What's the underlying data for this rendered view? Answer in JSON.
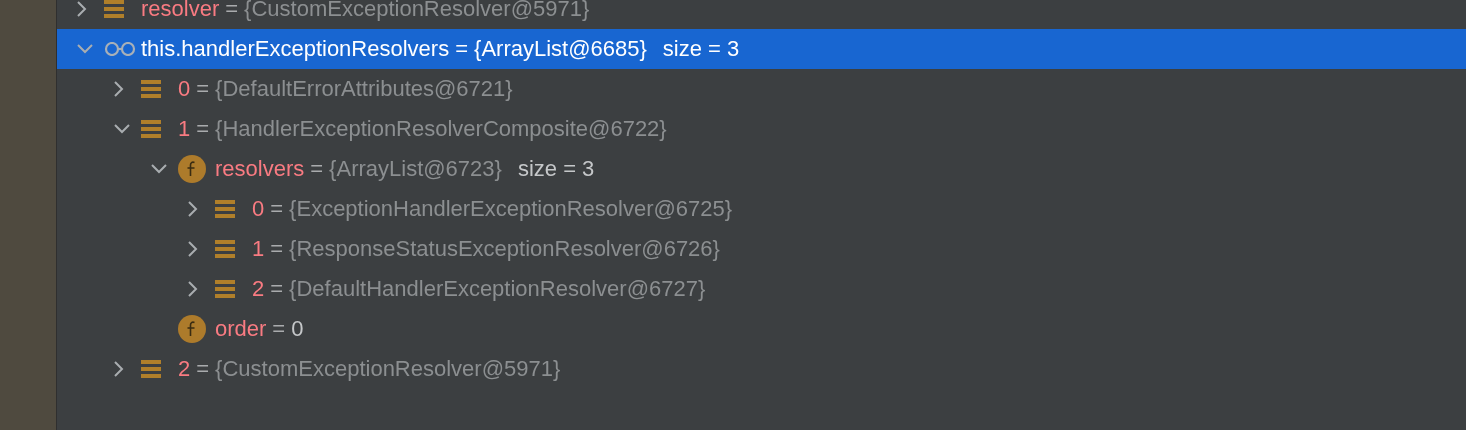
{
  "variables": [
    {
      "name": "resolver",
      "kind": "array",
      "operator": "=",
      "value": "{CustomExceptionResolver@5971}",
      "dimmed": true,
      "expanded": false,
      "selected": false
    },
    {
      "name": "this.handlerExceptionResolvers",
      "kind": "watch",
      "operator": "=",
      "value": "{ArrayList@6685}",
      "size": "size = 3",
      "dimmed": true,
      "expanded": true,
      "selected": true,
      "children": [
        {
          "name": "0",
          "kind": "array",
          "operator": "=",
          "value": "{DefaultErrorAttributes@6721}",
          "dimmed": true,
          "expanded": false,
          "selected": false
        },
        {
          "name": "1",
          "kind": "array",
          "operator": "=",
          "value": "{HandlerExceptionResolverComposite@6722}",
          "dimmed": true,
          "expanded": true,
          "selected": false,
          "children": [
            {
              "name": "resolvers",
              "kind": "field",
              "operator": "=",
              "value": "{ArrayList@6723}",
              "size": "size = 3",
              "dimmed": true,
              "expanded": true,
              "selected": false,
              "children": [
                {
                  "name": "0",
                  "kind": "array",
                  "operator": "=",
                  "value": "{ExceptionHandlerExceptionResolver@6725}",
                  "dimmed": true,
                  "expanded": false,
                  "selected": false
                },
                {
                  "name": "1",
                  "kind": "array",
                  "operator": "=",
                  "value": "{ResponseStatusExceptionResolver@6726}",
                  "dimmed": true,
                  "expanded": false,
                  "selected": false
                },
                {
                  "name": "2",
                  "kind": "array",
                  "operator": "=",
                  "value": "{DefaultHandlerExceptionResolver@6727}",
                  "dimmed": true,
                  "expanded": false,
                  "selected": false
                }
              ]
            },
            {
              "name": "order",
              "kind": "field",
              "operator": "=",
              "value": "0",
              "dimmed": false,
              "selected": false
            }
          ]
        },
        {
          "name": "2",
          "kind": "array",
          "operator": "=",
          "value": "{CustomExceptionResolver@5971}",
          "dimmed": true,
          "expanded": false,
          "selected": false
        }
      ]
    }
  ]
}
